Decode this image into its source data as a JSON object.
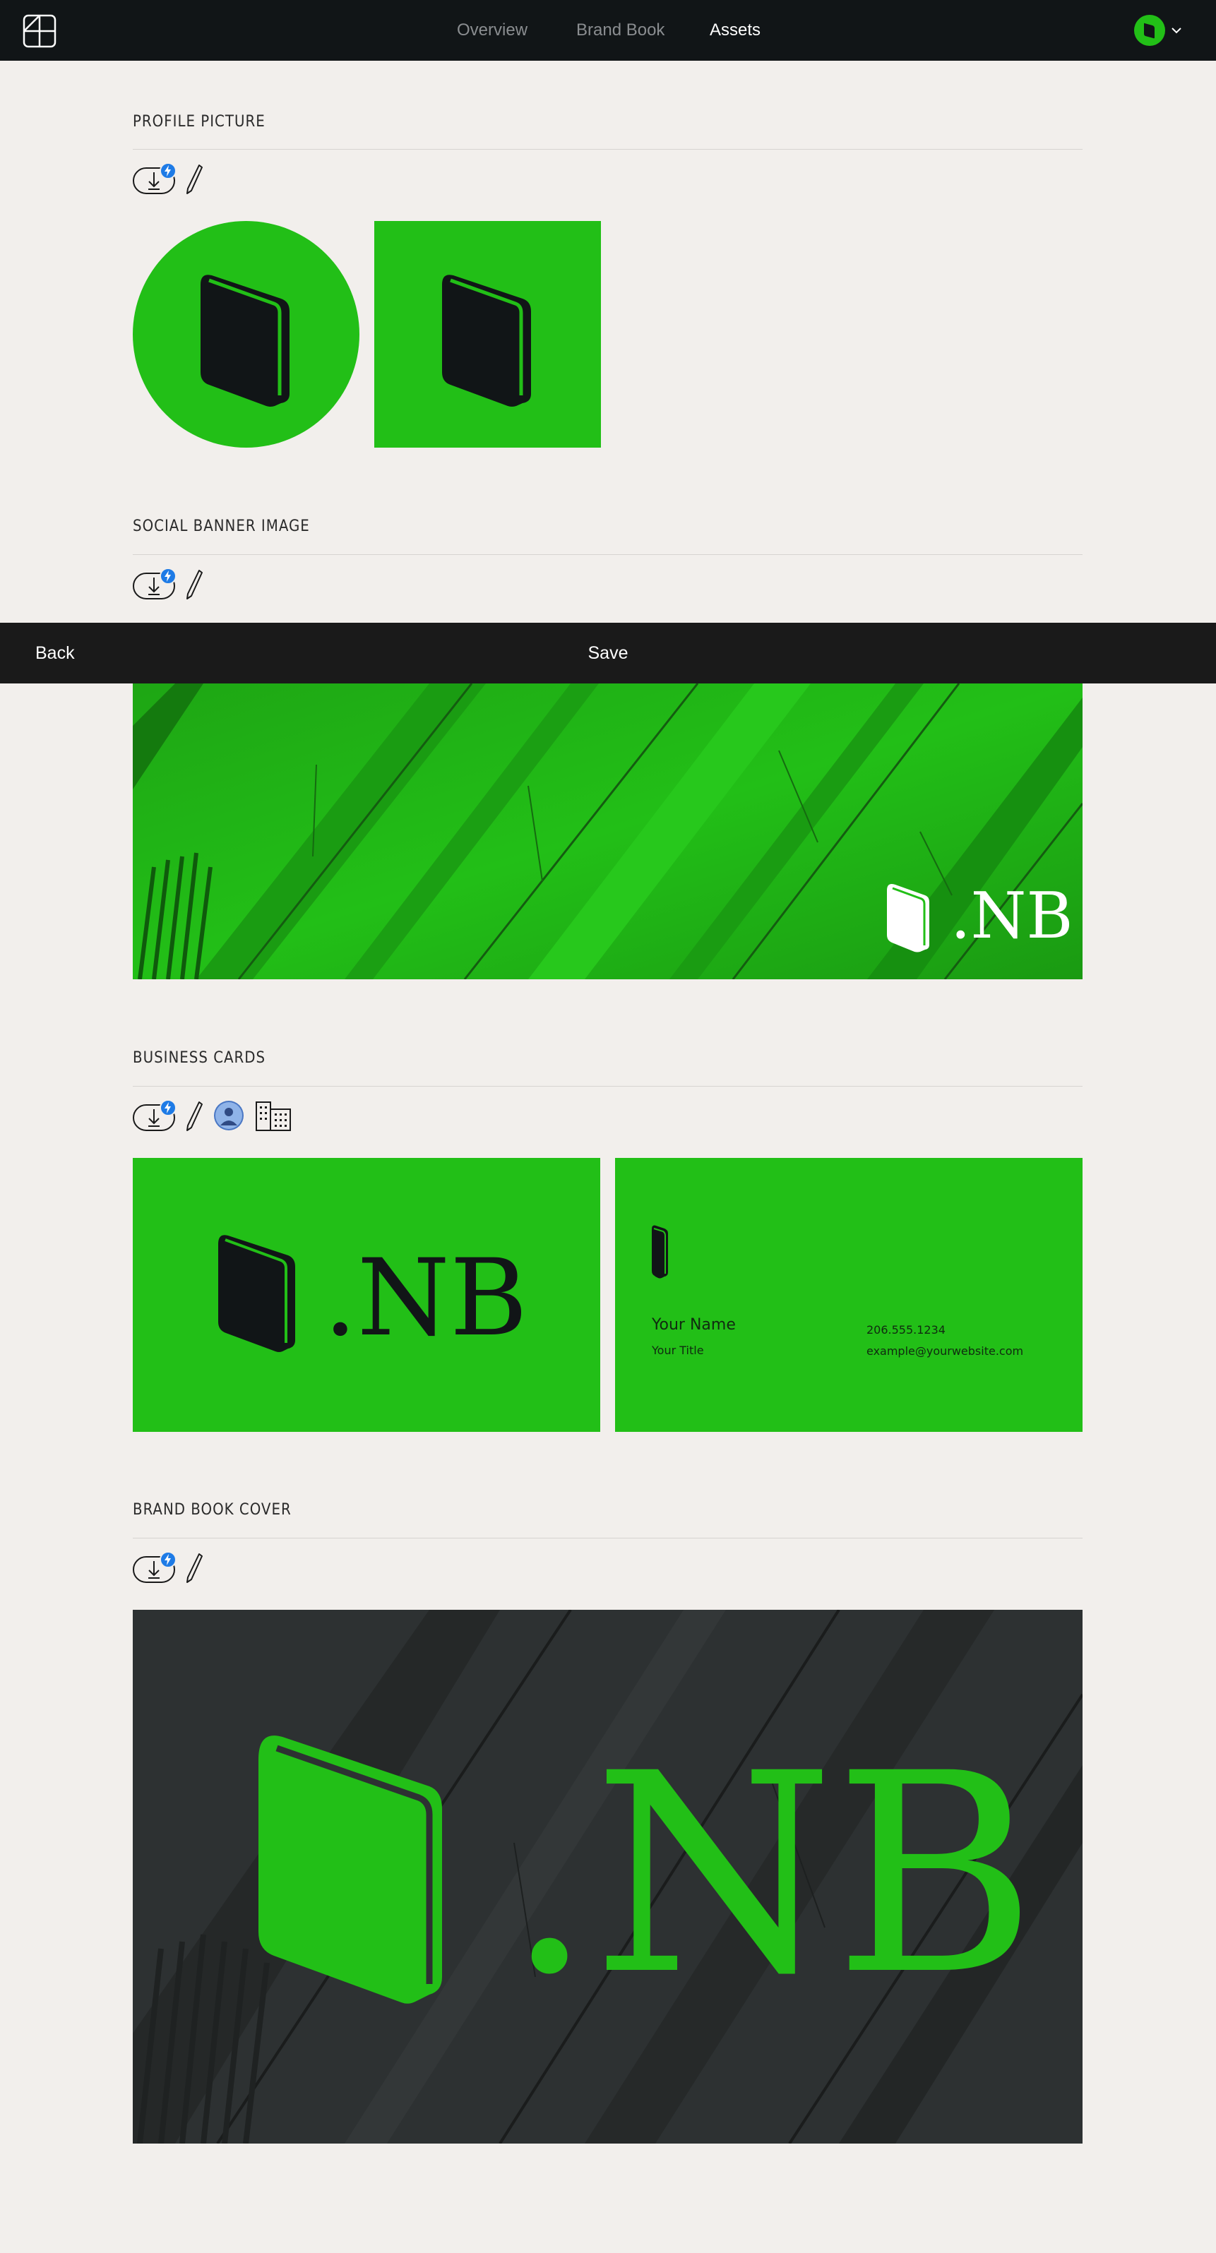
{
  "nav": {
    "items": [
      {
        "label": "Overview",
        "active": false
      },
      {
        "label": "Brand Book",
        "active": false
      },
      {
        "label": "Assets",
        "active": true
      }
    ]
  },
  "brand": {
    "accent": "#22bf17",
    "dark": "#111517",
    "wordmark": ".NB"
  },
  "sections": {
    "profile_picture": {
      "title": "PROFILE PICTURE"
    },
    "social_banner": {
      "title": "SOCIAL BANNER IMAGE"
    },
    "business_cards": {
      "title": "BUSINESS CARDS"
    },
    "brand_book_cover": {
      "title": "BRAND BOOK COVER"
    }
  },
  "business_card": {
    "name": "Your Name",
    "title": "Your Title",
    "phone": "206.555.1234",
    "email": "example@yourwebsite.com"
  },
  "actions": {
    "back": "Back",
    "save": "Save"
  },
  "icons": [
    "brand-logo-icon",
    "avatar-icon",
    "chevron-down-icon",
    "download-icon",
    "edit-pencil-icon",
    "person-avatar-icon",
    "building-icon",
    "book-icon"
  ]
}
